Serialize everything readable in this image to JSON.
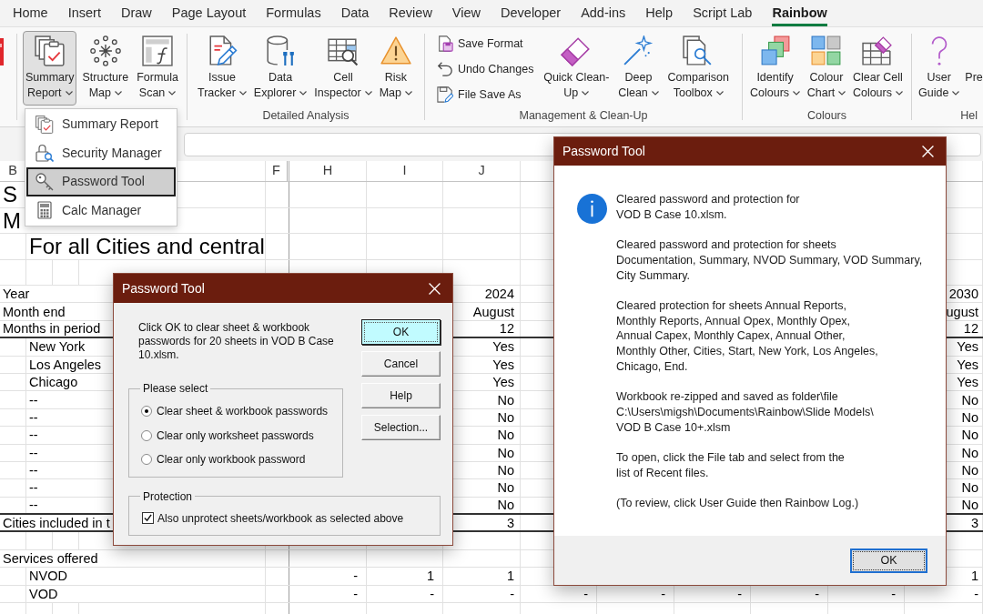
{
  "tabs": [
    {
      "label": "Home",
      "selected": false
    },
    {
      "label": "Insert",
      "selected": false
    },
    {
      "label": "Draw",
      "selected": false
    },
    {
      "label": "Page Layout",
      "selected": false
    },
    {
      "label": "Formulas",
      "selected": false
    },
    {
      "label": "Data",
      "selected": false
    },
    {
      "label": "Review",
      "selected": false
    },
    {
      "label": "View",
      "selected": false
    },
    {
      "label": "Developer",
      "selected": false
    },
    {
      "label": "Add-ins",
      "selected": false
    },
    {
      "label": "Help",
      "selected": false
    },
    {
      "label": "Script Lab",
      "selected": false
    },
    {
      "label": "Rainbow",
      "selected": true
    }
  ],
  "ribbon": {
    "groups": [
      {
        "buttons": [
          {
            "kind": "large",
            "lines": [
              "Summary",
              "Report"
            ],
            "dropdown": true,
            "pressed": true
          },
          {
            "kind": "large",
            "lines": [
              "Structure",
              "Map"
            ],
            "dropdown": true,
            "pressed": false
          },
          {
            "kind": "large",
            "lines": [
              "Formula",
              "Scan"
            ],
            "dropdown": true,
            "pressed": false
          }
        ]
      },
      {
        "label": "Detailed Analysis",
        "buttons": [
          {
            "kind": "large",
            "lines": [
              "Issue",
              "Tracker"
            ],
            "dropdown": true,
            "pressed": false
          },
          {
            "kind": "large",
            "lines": [
              "Data",
              "Explorer"
            ],
            "dropdown": true,
            "pressed": false
          },
          {
            "kind": "large",
            "lines": [
              "Cell",
              "Inspector"
            ],
            "dropdown": true,
            "pressed": false
          },
          {
            "kind": "large",
            "lines": [
              "Risk",
              "Map"
            ],
            "dropdown": true,
            "pressed": false
          }
        ]
      },
      {
        "label": "Management & Clean-Up",
        "buttons": [
          {
            "kind": "small",
            "label": "Save Format",
            "pressed": false
          },
          {
            "kind": "small",
            "label": "Undo Changes",
            "pressed": false
          },
          {
            "kind": "small",
            "label": "File Save As",
            "pressed": false
          },
          {
            "kind": "large",
            "lines": [
              "Quick Clean-",
              "Up"
            ],
            "dropdown": true,
            "pressed": false
          },
          {
            "kind": "large",
            "lines": [
              "Deep",
              "Clean"
            ],
            "dropdown": true,
            "pressed": false
          },
          {
            "kind": "large",
            "lines": [
              "Comparison",
              "Toolbox"
            ],
            "dropdown": true,
            "pressed": false
          }
        ]
      },
      {
        "label": "Colours",
        "buttons": [
          {
            "kind": "large",
            "lines": [
              "Identify",
              "Colours"
            ],
            "dropdown": true,
            "pressed": false
          },
          {
            "kind": "large",
            "lines": [
              "Colour",
              "Chart"
            ],
            "dropdown": true,
            "pressed": false
          },
          {
            "kind": "large",
            "lines": [
              "Clear Cell",
              "Colours"
            ],
            "dropdown": true,
            "pressed": false
          }
        ]
      },
      {
        "label": "Hel",
        "buttons": [
          {
            "kind": "large",
            "lines": [
              "User",
              "Guide"
            ],
            "dropdown": true,
            "pressed": false
          },
          {
            "kind": "large",
            "lines": [
              "Pre"
            ],
            "dropdown": false,
            "pressed": false
          }
        ]
      }
    ]
  },
  "dropdown_menu": {
    "items": [
      {
        "label": "Summary Report",
        "selected": false
      },
      {
        "label": "Security Manager",
        "selected": false
      },
      {
        "label": "Password Tool",
        "selected": true
      },
      {
        "label": "Calc Manager",
        "selected": false
      }
    ]
  },
  "sheet": {
    "column_headers": [
      "B",
      "F",
      "H",
      "I",
      "J"
    ],
    "rows": [
      {
        "kind": "title",
        "label": "S",
        "rule_below": false
      },
      {
        "kind": "title",
        "label": "M",
        "rule_below": false
      },
      {
        "kind": "subtitle",
        "label": "For all Cities and central",
        "rule_below": false
      },
      {
        "kind": "spacer",
        "rule_below": false
      },
      {
        "kind": "heading",
        "label": "Year",
        "j": "2024",
        "column_14": "2030",
        "rule_below": false
      },
      {
        "kind": "heading",
        "label": "Month end",
        "j": "August",
        "column_14": "ugust",
        "rule_below": false
      },
      {
        "kind": "heading",
        "label": "Months in period",
        "j": "12",
        "column_14": "12",
        "rule_below": true
      },
      {
        "kind": "item",
        "label": "New York",
        "j": "Yes",
        "column_14": "Yes",
        "rule_below": false
      },
      {
        "kind": "item",
        "label": "Los Angeles",
        "j": "Yes",
        "column_14": "Yes",
        "rule_below": false
      },
      {
        "kind": "item",
        "label": "Chicago",
        "j": "Yes",
        "column_14": "Yes",
        "rule_below": false
      },
      {
        "kind": "item",
        "label": "--",
        "j": "No",
        "column_14": "No",
        "rule_below": false
      },
      {
        "kind": "item",
        "label": "--",
        "j": "No",
        "column_14": "No",
        "rule_below": false
      },
      {
        "kind": "item",
        "label": "--",
        "j": "No",
        "column_14": "No",
        "rule_below": false
      },
      {
        "kind": "item",
        "label": "--",
        "j": "No",
        "column_14": "No",
        "rule_below": false
      },
      {
        "kind": "item",
        "label": "--",
        "j": "No",
        "column_14": "No",
        "rule_below": false
      },
      {
        "kind": "item",
        "label": "--",
        "j": "No",
        "column_14": "No",
        "rule_below": false
      },
      {
        "kind": "item",
        "label": "--",
        "j": "No",
        "column_14": "No",
        "rule_below": true
      },
      {
        "kind": "heading",
        "label": "Cities included in t",
        "j": "3",
        "column_14": "3",
        "rule_below": true
      },
      {
        "kind": "blank",
        "rule_below": false
      },
      {
        "kind": "heading",
        "label": "Services offered",
        "rule_below": false
      },
      {
        "kind": "item",
        "label": "NVOD",
        "h": "-",
        "i": "1",
        "j": "1",
        "column_14": "1",
        "rule_below": false
      },
      {
        "kind": "item",
        "label": "VOD",
        "h": "-",
        "i": "-",
        "j": "-",
        "column_9": "-",
        "column_10": "-",
        "column_11": "-",
        "column_12": "-",
        "column_13": "-",
        "column_14": "-",
        "rule_below": false
      }
    ]
  },
  "options_dialog": {
    "title": "Password Tool",
    "message": "Click OK to clear sheet & workbook passwords for 20 sheets in VOD B Case 10.xlsm.",
    "buttons": [
      {
        "label": "OK",
        "focused": true
      },
      {
        "label": "Cancel",
        "focused": false
      },
      {
        "label": "Help",
        "focused": false
      },
      {
        "label": "Selection...",
        "focused": false
      }
    ],
    "select_group": {
      "title": "Please select",
      "options": [
        {
          "label": "Clear sheet & workbook passwords",
          "selected": true
        },
        {
          "label": "Clear only worksheet passwords",
          "selected": false
        },
        {
          "label": "Clear only workbook password",
          "selected": false
        }
      ]
    },
    "protection_group": {
      "title": "Protection",
      "checkbox": {
        "label": "Also unprotect sheets/workbook as selected above",
        "checked": true
      }
    }
  },
  "message_box": {
    "title": "Password Tool",
    "paragraphs": [
      "Cleared password and protection for\nVOD B Case 10.xlsm.",
      "Cleared password and protection for sheets\nDocumentation, Summary, NVOD Summary, VOD Summary,\nCity Summary.",
      "Cleared protection for sheets Annual Reports,\nMonthly Reports, Annual Opex, Monthly Opex,\nAnnual Capex, Monthly Capex, Annual Other,\nMonthly Other, Cities, Start, New York, Los Angeles,\nChicago, End.",
      "Workbook re-zipped and saved as folder\\file\nC:\\Users\\migsh\\Documents\\Rainbow\\Slide Models\\\nVOD B Case 10+.xlsm",
      "To open, click the File tab and select from the\nlist of Recent files.",
      "(To review, click User Guide then Rainbow Log.)"
    ],
    "buttons": [
      {
        "label": "OK",
        "focused": true
      }
    ]
  }
}
